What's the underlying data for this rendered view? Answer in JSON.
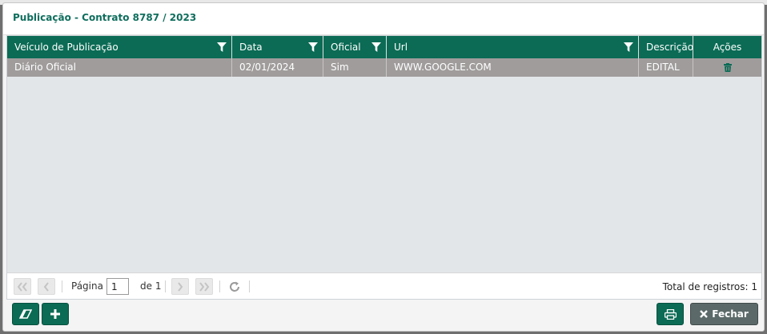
{
  "dialog": {
    "title": "Publicação - Contrato 8787 / 2023"
  },
  "grid": {
    "columns": [
      {
        "label": "Veículo de Publicação",
        "filter": true
      },
      {
        "label": "Data",
        "filter": true
      },
      {
        "label": "Oficial",
        "filter": true
      },
      {
        "label": "Url",
        "filter": true
      },
      {
        "label": "Descrição",
        "filter": false
      },
      {
        "label": "Ações",
        "filter": false
      }
    ],
    "rows": [
      {
        "veiculo": "Diário Oficial",
        "data": "02/01/2024",
        "oficial": "Sim",
        "url": "WWW.GOOGLE.COM",
        "descricao": "EDITAL",
        "acao_icon": "trash-icon"
      }
    ]
  },
  "pager": {
    "page_label": "Página",
    "page_value": "1",
    "of_label": "de 1",
    "total_label": "Total de registros: 1"
  },
  "footer": {
    "clear_icon": "eraser-icon",
    "add_icon": "plus-icon",
    "print_icon": "printer-icon",
    "close_label": "Fechar"
  },
  "colors": {
    "primary": "#0b6b55",
    "title": "#0f6e5d",
    "selected_row": "#a09c9c",
    "close_button": "#5b6a69"
  }
}
